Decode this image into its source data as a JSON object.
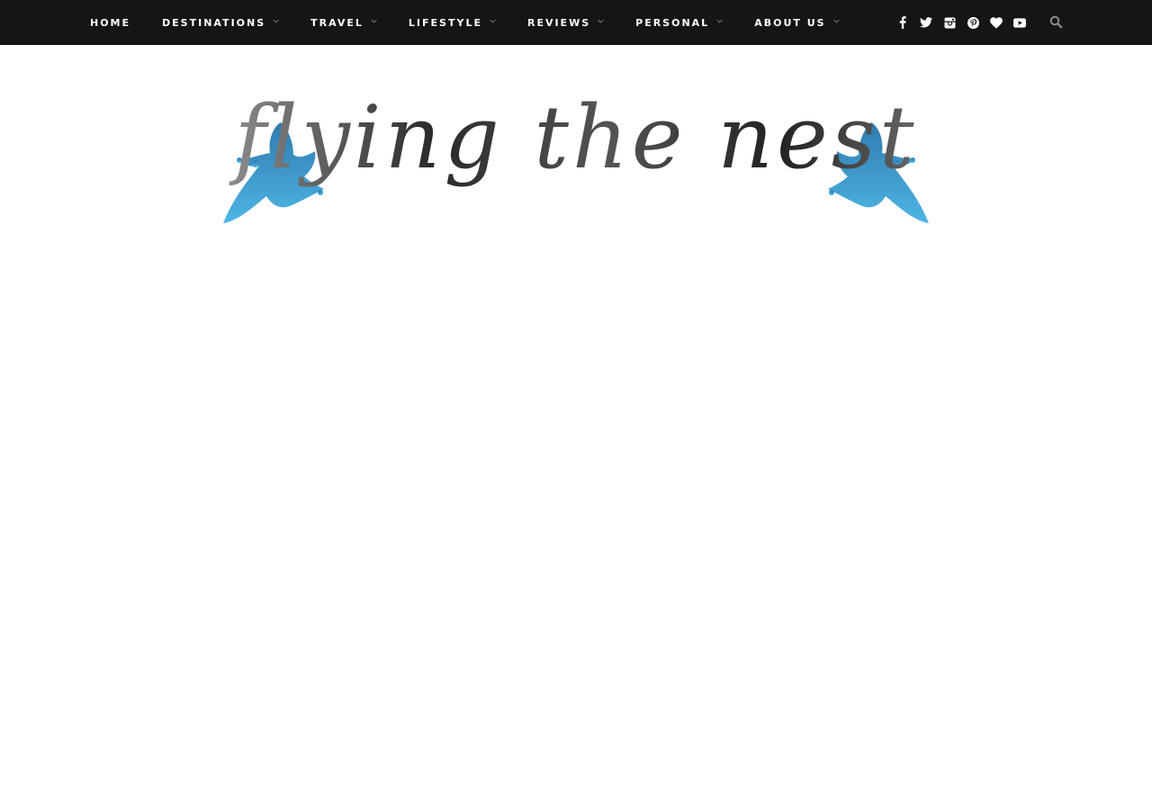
{
  "nav": {
    "items": [
      {
        "label": "HOME",
        "has_dropdown": false
      },
      {
        "label": "DESTINATIONS",
        "has_dropdown": true
      },
      {
        "label": "TRAVEL",
        "has_dropdown": true
      },
      {
        "label": "LIFESTYLE",
        "has_dropdown": true
      },
      {
        "label": "REVIEWS",
        "has_dropdown": true
      },
      {
        "label": "PERSONAL",
        "has_dropdown": true
      },
      {
        "label": "ABOUT US",
        "has_dropdown": true
      }
    ]
  },
  "social": {
    "icons": [
      "facebook-icon",
      "twitter-icon",
      "instagram-icon",
      "pinterest-icon",
      "heart-icon",
      "youtube-icon"
    ]
  },
  "search": {
    "icon": "search-icon"
  },
  "logo": {
    "text": "flying the nest",
    "bird_color": "#2a8fc9"
  },
  "colors": {
    "topbar": "#151515",
    "nav_text": "#ffffff",
    "background": "#ffffff"
  }
}
